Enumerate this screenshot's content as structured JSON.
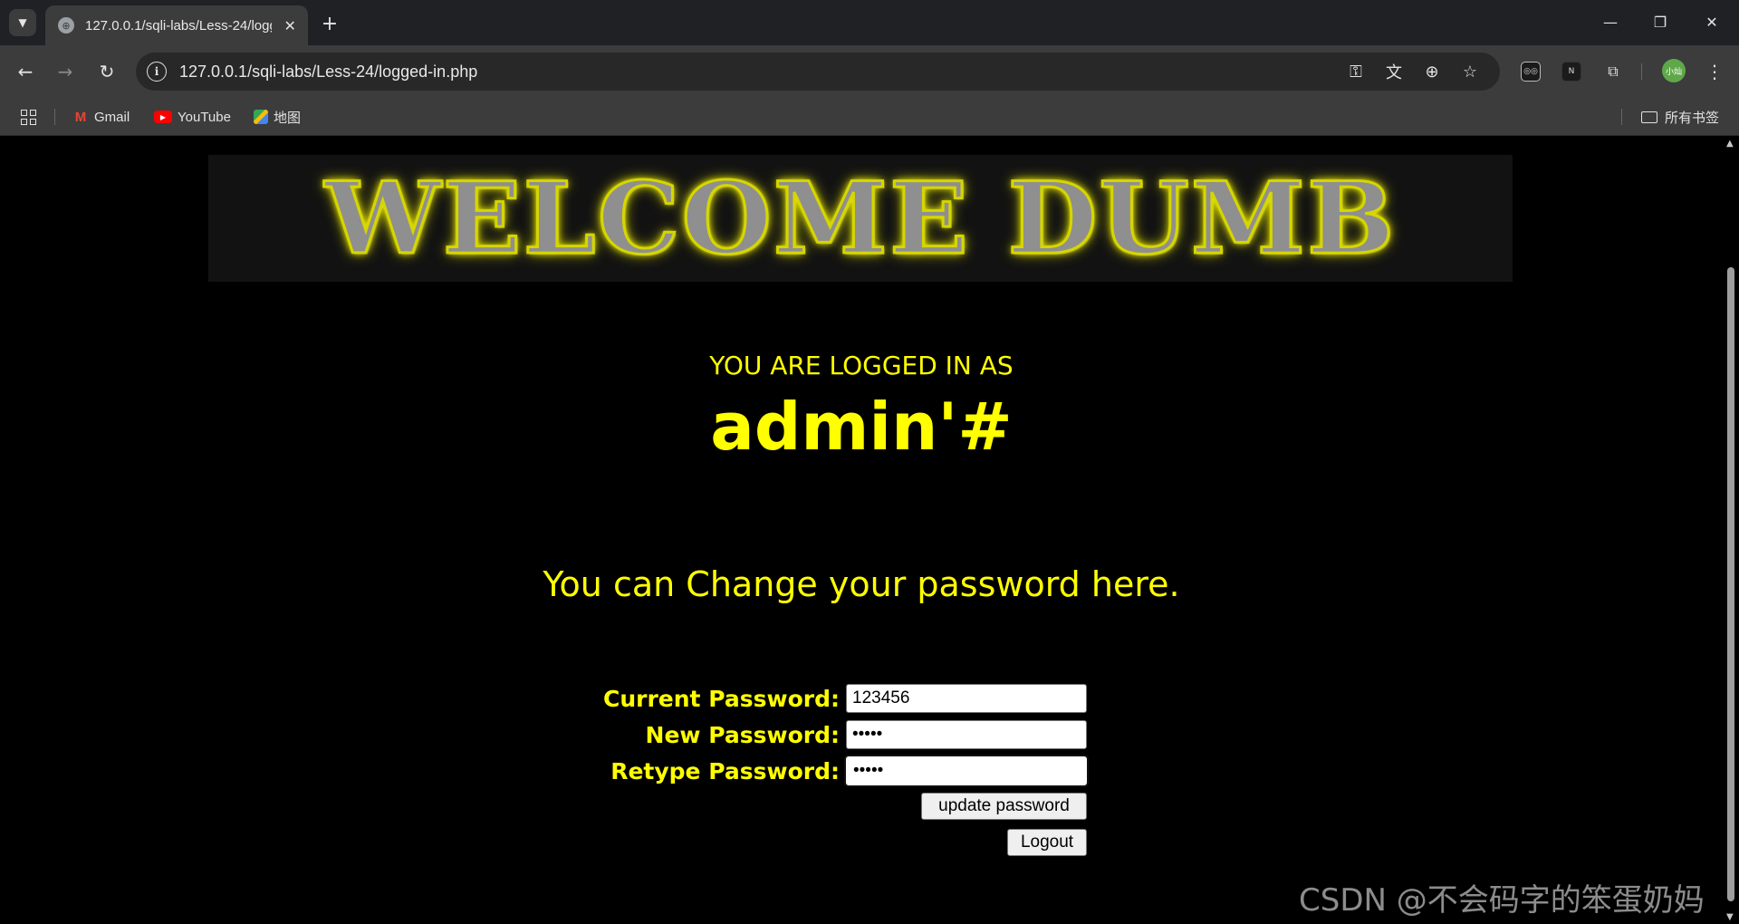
{
  "browser": {
    "tab_title": "127.0.0.1/sqli-labs/Less-24/logged-in.php",
    "url": "127.0.0.1/sqli-labs/Less-24/logged-in.php",
    "profile_label": "小灿",
    "bookmarks": [
      {
        "label": "Gmail",
        "icon": "gmail-icon"
      },
      {
        "label": "YouTube",
        "icon": "youtube-icon"
      },
      {
        "label": "地图",
        "icon": "maps-icon"
      }
    ],
    "all_bookmarks_label": "所有书签"
  },
  "page": {
    "banner_text": "WELCOME DUMB",
    "logged_in_label": "YOU ARE LOGGED IN AS",
    "username": "admin'#",
    "change_message": "You can Change your password here.",
    "form": {
      "current_password_label": "Current Password:",
      "current_password_value": "123456",
      "new_password_label": "New Password:",
      "new_password_value": "•••••",
      "retype_password_label": "Retype Password:",
      "retype_password_value": "•••••",
      "update_button": "update password",
      "logout_button": "Logout"
    }
  },
  "watermark": "CSDN @不会码字的笨蛋奶妈",
  "colors": {
    "accent": "#ffff00",
    "page_background": "#000000",
    "chrome_dark": "#202124",
    "chrome_toolbar": "#3c3c3c"
  }
}
